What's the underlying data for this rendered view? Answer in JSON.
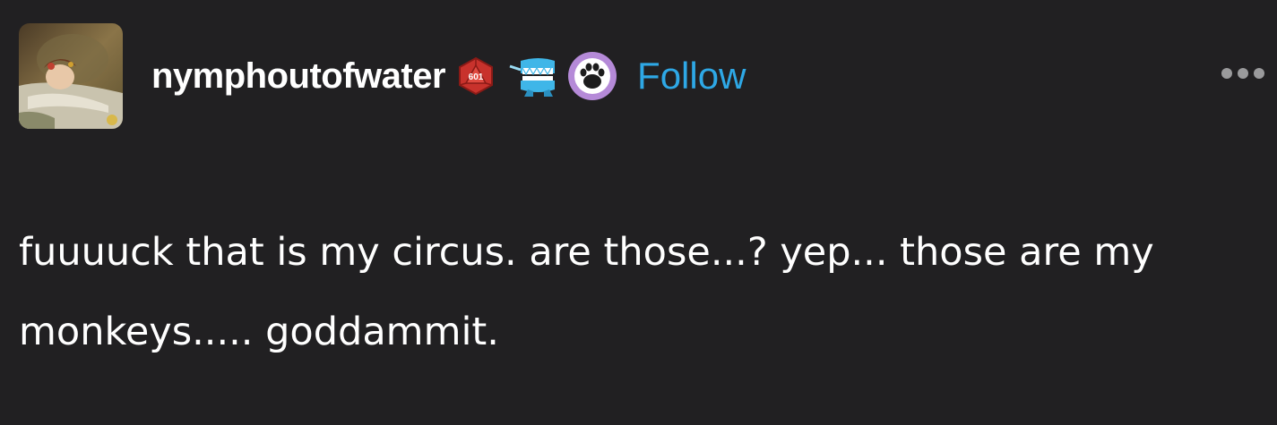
{
  "post": {
    "author": {
      "username": "nymphoutofwater",
      "avatar_icon": "painting-avatar-icon",
      "badges": [
        {
          "icon": "d20-dice-icon",
          "label": "601",
          "color": "#c8322c"
        },
        {
          "icon": "wind-up-teeth-icon",
          "color": "#3fb6e8"
        },
        {
          "icon": "paw-print-icon",
          "color": "#b58ad8"
        }
      ]
    },
    "follow_label": "Follow",
    "menu_icon": "more-options-icon",
    "text": "fuuuuck that is my circus. are those...? yep... those are my monkeys..... goddammit."
  },
  "colors": {
    "background": "#212022",
    "text": "#ffffff",
    "accent": "#2ea8e6",
    "menu": "#9a9a9c"
  }
}
